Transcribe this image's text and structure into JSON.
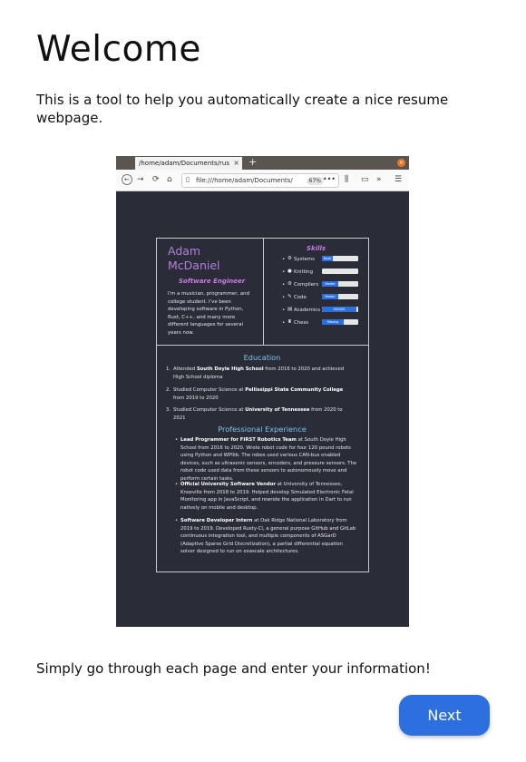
{
  "page": {
    "title": "Welcome",
    "intro": "This is a tool to help you automatically create a nice resume webpage.",
    "instruction": "Simply go through each page and enter your information!",
    "next_label": "Next",
    "accent_color": "#2e6fe0"
  },
  "browser": {
    "tab_title": "/home/adam/Documents/rus",
    "tab_close": "×",
    "new_tab": "+",
    "window_close": "×",
    "url": "file:///home/adam/Documents/",
    "zoom": "67%",
    "more": "•••",
    "icons": [
      "back-arrow-icon",
      "forward-arrow-icon",
      "reload-icon",
      "home-icon",
      "page-icon",
      "library-icon",
      "sidebar-icon",
      "overflow-icon",
      "menu-icon"
    ]
  },
  "resume": {
    "name_line1": "Adam",
    "name_line2": "McDaniel",
    "role": "Software Engineer",
    "bio": "I'm a musician, programmer, and college student. I've been developing software in Python, Rust, C++, and many more different languages for several years now.",
    "skills_title": "Skills",
    "skills": [
      {
        "label": "Systems",
        "icon": "gear-icon",
        "level": 0.3,
        "bar_text": "Noob"
      },
      {
        "label": "Knitting",
        "icon": "yarn-icon",
        "level": 0.0,
        "bar_text": ""
      },
      {
        "label": "Compilers",
        "icon": "cog-icon",
        "level": 0.45,
        "bar_text": "Master"
      },
      {
        "label": "Code",
        "icon": "pencil-icon",
        "level": 0.45,
        "bar_text": "Master"
      },
      {
        "label": "Academics",
        "icon": "book-icon",
        "level": 0.95,
        "bar_text": "GENIUS"
      },
      {
        "label": "Chess",
        "icon": "chess-icon",
        "level": 0.6,
        "bar_text": "Missing"
      }
    ],
    "education_title": "Education",
    "education": [
      {
        "num": "1.",
        "pre": "Attended ",
        "bold": "South Doyle High School",
        "post": " from 2016 to 2020 and achieved High School diploma"
      },
      {
        "num": "2.",
        "pre": "Studied Computer Science at ",
        "bold": "Pellissippi State Community College",
        "post": " from 2019 to 2020"
      },
      {
        "num": "3.",
        "pre": "Studied Computer Science at ",
        "bold": "University of Tennessee",
        "post": " from 2020 to 2021"
      }
    ],
    "experience_title": "Professional Experience",
    "experience": [
      {
        "bold": "Lead Programmer for FIRST Robotics Team",
        "text": " at South Doyle High School from 2016 to 2020. Wrote robot code for four 120 pound robots using Python and WPIlib. The robos used various CAN-bus enabled devices, such as ultrasonic sensors, encoders, and pressure sensors. The robot code used data from these sensors to autonomously move and perform certain tasks."
      },
      {
        "bold": "Official University Software Vendor",
        "text": " at University of Tennessee, Knoxville from 2018 to 2019. Helped develop Simulated Electronic Fetal Monitoring app in JavaScript, and rewrote the application in Dart to run natively on mobile and desktop."
      },
      {
        "bold": "Software Developer Intern",
        "text": " at Oak Ridge National Laboratory from 2019 to 2019. Developed Rusty-CI, a general purpose GitHub and GitLab continuous integration tool, and multiple components of ASGarD (Adaptive Sparse Grid Discretization), a partial differential equation solver designed to run on exascale architectures."
      }
    ]
  }
}
